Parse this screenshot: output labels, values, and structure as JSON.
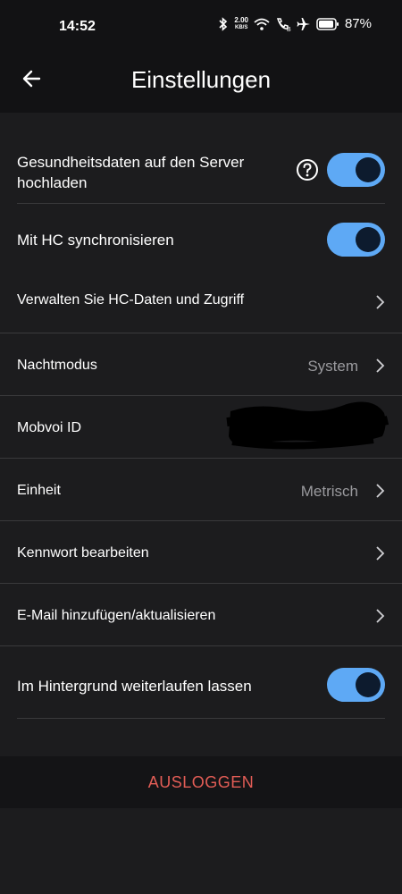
{
  "status": {
    "time": "14:52",
    "speed_value": "2.00",
    "speed_unit": "KB/S",
    "battery": "87%"
  },
  "header": {
    "title": "Einstellungen"
  },
  "settings": {
    "upload_health": {
      "label_line1": "Gesundheitsdaten auf den Server",
      "label_line2": "hochladen",
      "on": true
    },
    "sync_hc": {
      "label": "Mit HC synchronisieren",
      "on": true
    },
    "manage_hc": {
      "label": "Verwalten Sie HC-Daten und Zugriff"
    },
    "night_mode": {
      "label": "Nachtmodus",
      "value": "System"
    },
    "mobvoi_id": {
      "label": "Mobvoi ID"
    },
    "unit": {
      "label": "Einheit",
      "value": "Metrisch"
    },
    "password": {
      "label": "Kennwort bearbeiten"
    },
    "email": {
      "label": "E-Mail hinzufügen/aktualisieren"
    },
    "background": {
      "label": "Im Hintergrund weiterlaufen lassen",
      "on": true
    }
  },
  "logout": {
    "label": "AUSLOGGEN"
  },
  "colors": {
    "accent": "#5ea9f5",
    "danger": "#e35d56",
    "background": "#1c1c1e"
  }
}
